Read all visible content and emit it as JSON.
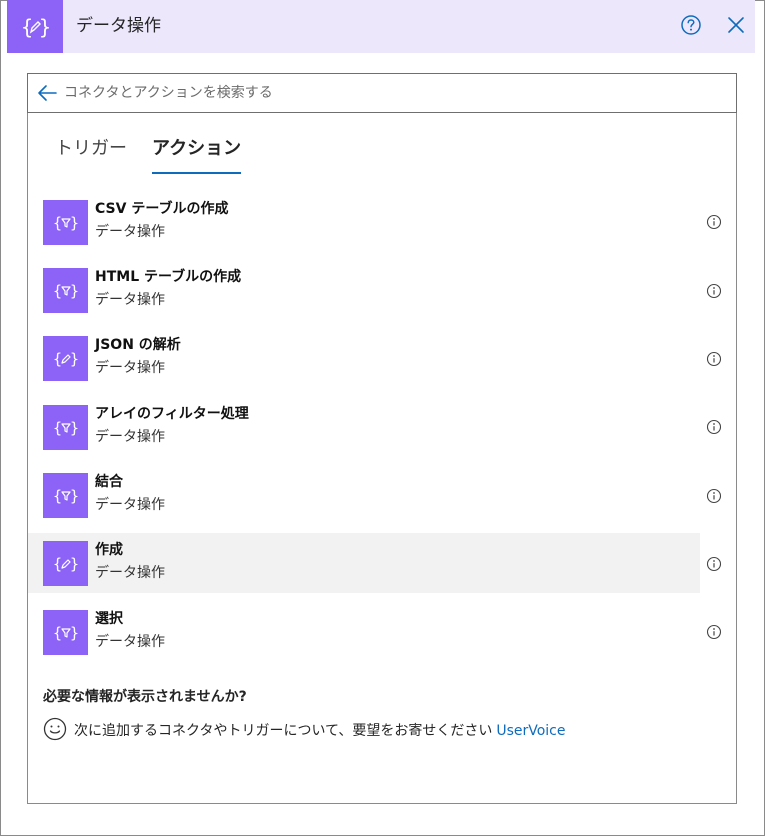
{
  "header": {
    "title": "データ操作",
    "help_icon": "question-circle-icon",
    "close_icon": "close-icon",
    "brand_color": "#8c63f6",
    "header_bg": "#ede7fc"
  },
  "search": {
    "placeholder": "コネクタとアクションを検索する",
    "value": ""
  },
  "tabs": [
    {
      "label": "トリガー",
      "selected": false
    },
    {
      "label": "アクション",
      "selected": true
    }
  ],
  "actions": [
    {
      "title": "CSV テーブルの作成",
      "subtitle": "データ操作",
      "icon": "data-filter-icon",
      "selected": false
    },
    {
      "title": "HTML テーブルの作成",
      "subtitle": "データ操作",
      "icon": "data-filter-icon",
      "selected": false
    },
    {
      "title": "JSON の解析",
      "subtitle": "データ操作",
      "icon": "data-edit-icon",
      "selected": false
    },
    {
      "title": "アレイのフィルター処理",
      "subtitle": "データ操作",
      "icon": "data-filter-icon",
      "selected": false
    },
    {
      "title": "結合",
      "subtitle": "データ操作",
      "icon": "data-filter-icon",
      "selected": false
    },
    {
      "title": "作成",
      "subtitle": "データ操作",
      "icon": "data-edit-icon",
      "selected": true
    },
    {
      "title": "選択",
      "subtitle": "データ操作",
      "icon": "data-filter-icon",
      "selected": false
    }
  ],
  "footer": {
    "question": "必要な情報が表示されませんか?",
    "feedback_text": "次に追加するコネクタやトリガーについて、要望をお寄せください",
    "link_label": "UserVoice",
    "link_color": "#0f6cbd"
  }
}
